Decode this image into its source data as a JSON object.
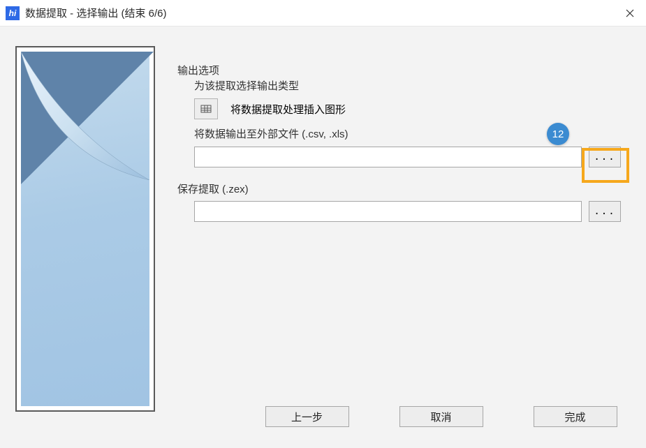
{
  "window": {
    "title": "数据提取 - 选择输出 (结束 6/6)",
    "app_icon_glyph": "hi"
  },
  "output_options": {
    "group_title": "输出选项",
    "subtitle": "为该提取选择输出类型",
    "insert_label": "将数据提取处理插入图形",
    "external_label": "将数据输出至外部文件 (.csv, .xls)",
    "external_value": "",
    "browse_label": "..."
  },
  "save_extract": {
    "group_title": "保存提取 (.zex)",
    "value": "",
    "browse_label": "..."
  },
  "hint_badge": "12",
  "buttons": {
    "back": "上一步",
    "cancel": "取消",
    "finish": "完成"
  }
}
